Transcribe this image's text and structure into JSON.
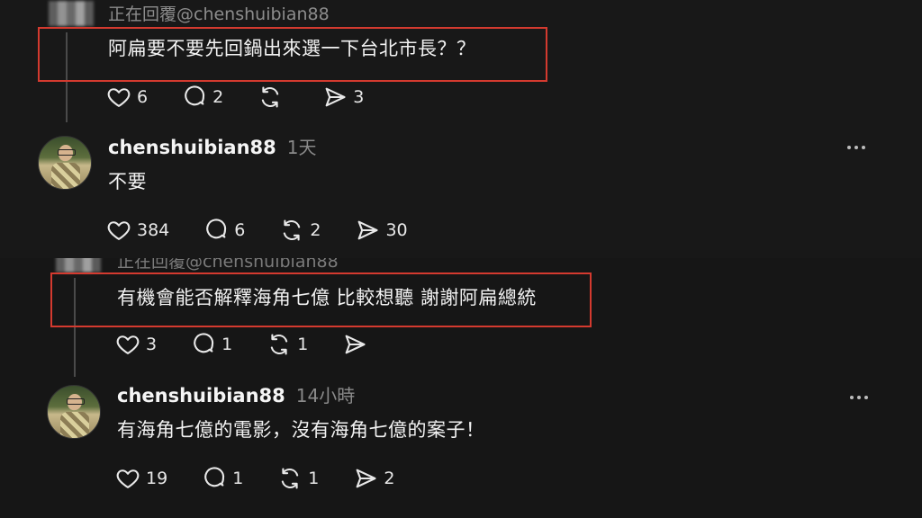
{
  "top": {
    "reply": {
      "replying_to": "正在回覆@chenshuibian88",
      "text": "阿扁要不要先回鍋出來選一下台北市長？？",
      "likes": "6",
      "comments": "2",
      "reposts": "",
      "shares": "3"
    },
    "answer": {
      "username": "chenshuibian88",
      "time": "1天",
      "text": "不要",
      "likes": "384",
      "comments": "6",
      "reposts": "2",
      "shares": "30"
    }
  },
  "bottom": {
    "reply": {
      "replying_to": "正在回覆@chenshuibian88",
      "text": "有機會能否解釋海角七億 比較想聽 謝謝阿扁總統",
      "likes": "3",
      "comments": "1",
      "reposts": "1",
      "shares": ""
    },
    "answer": {
      "username": "chenshuibian88",
      "time": "14小時",
      "text": "有海角七億的電影，沒有海角七億的案子！",
      "likes": "19",
      "comments": "1",
      "reposts": "1",
      "shares": "2"
    }
  },
  "icons": [
    "heart-icon",
    "comment-icon",
    "repost-icon",
    "share-icon",
    "more-icon"
  ],
  "colors": {
    "highlight_border": "#d43a2f",
    "background": "#181818"
  }
}
